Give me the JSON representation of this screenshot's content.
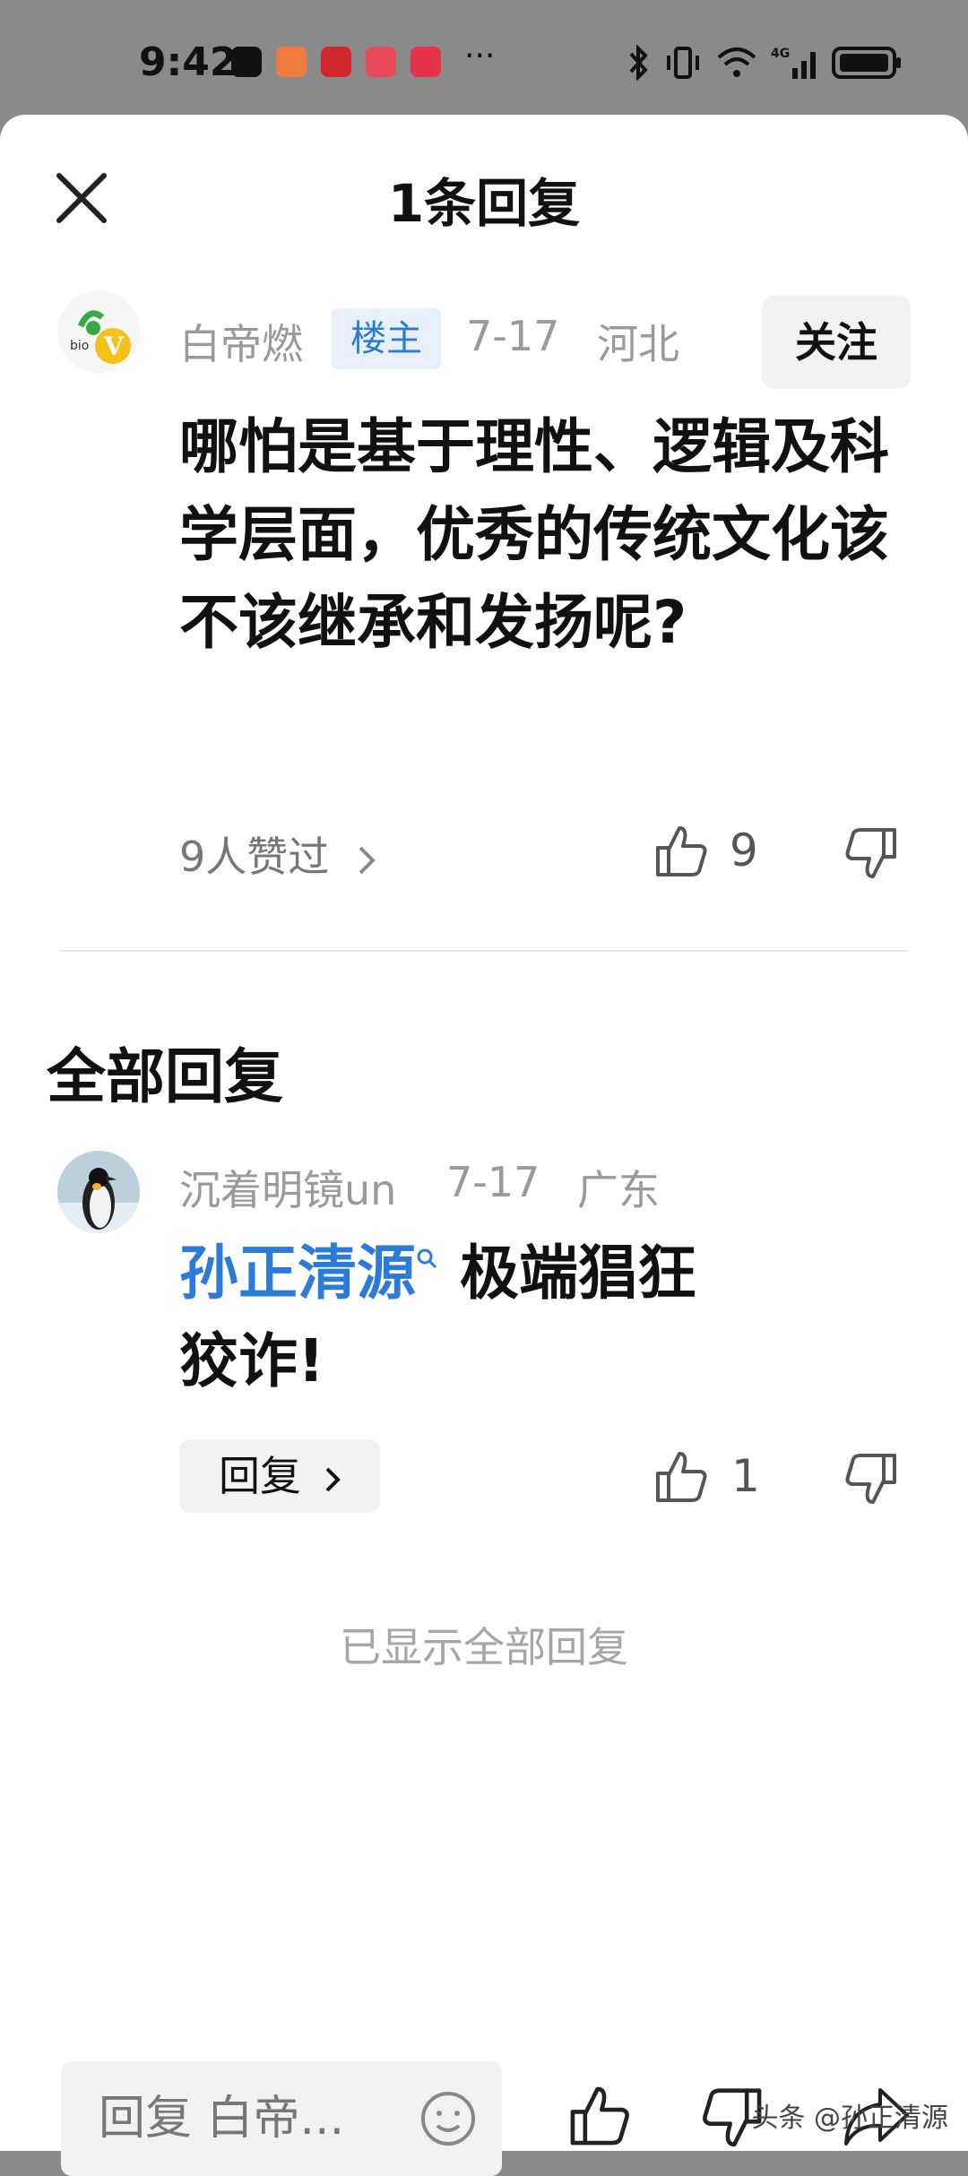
{
  "status": {
    "time": "9:42",
    "dots": "···"
  },
  "header": {
    "title": "1条回复"
  },
  "post": {
    "author": "白帝燃",
    "badge": "楼主",
    "date": "7-17",
    "location": "河北",
    "follow_label": "关注",
    "content": "哪怕是基于理性、逻辑及科学层面，优秀的传统文化该不该继承和发扬呢?",
    "likers_text": "9人赞过",
    "like_count": "9"
  },
  "replies_section": {
    "title": "全部回复"
  },
  "replies": [
    {
      "author": "沉着明镜un",
      "date": "7-17",
      "location": "广东",
      "mention": "孙正清源",
      "text_line1": " 极端猖狂",
      "text_line2": "狡诈!",
      "reply_label": "回复",
      "like_count": "1"
    }
  ],
  "end_note": "已显示全部回复",
  "bottom": {
    "input_placeholder": "回复 白帝..."
  },
  "watermark": "头条 @孙正清源"
}
